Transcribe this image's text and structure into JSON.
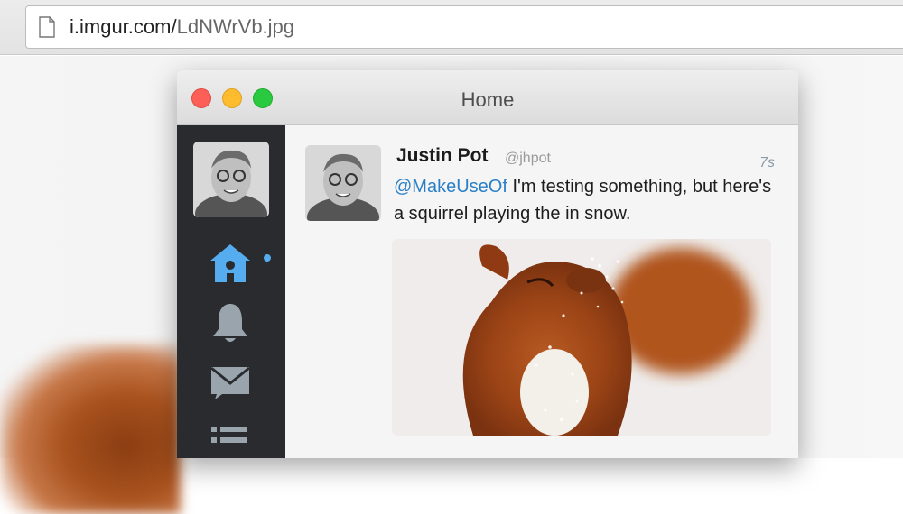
{
  "browser": {
    "url_host": "i.imgur.com/",
    "url_path": "LdNWrVb.jpg"
  },
  "window": {
    "title": "Home"
  },
  "sidebar": {
    "items": [
      {
        "icon": "home-icon",
        "active": true
      },
      {
        "icon": "bell-icon",
        "active": false
      },
      {
        "icon": "envelope-icon",
        "active": false
      },
      {
        "icon": "list-icon",
        "active": false
      }
    ]
  },
  "tweet": {
    "author_name": "Justin Pot",
    "author_handle": "@jhpot",
    "time": "7s",
    "mention": "@MakeUseOf",
    "text": " I'm testing something, but here's a squirrel playing the in snow.",
    "media": "squirrel-photo"
  },
  "colors": {
    "sidebar_bg": "#292b2f",
    "accent": "#55acee",
    "mention": "#2a7fc6",
    "close": "#fc5f57",
    "minimize": "#fdbc2e",
    "maximize": "#29c940"
  }
}
